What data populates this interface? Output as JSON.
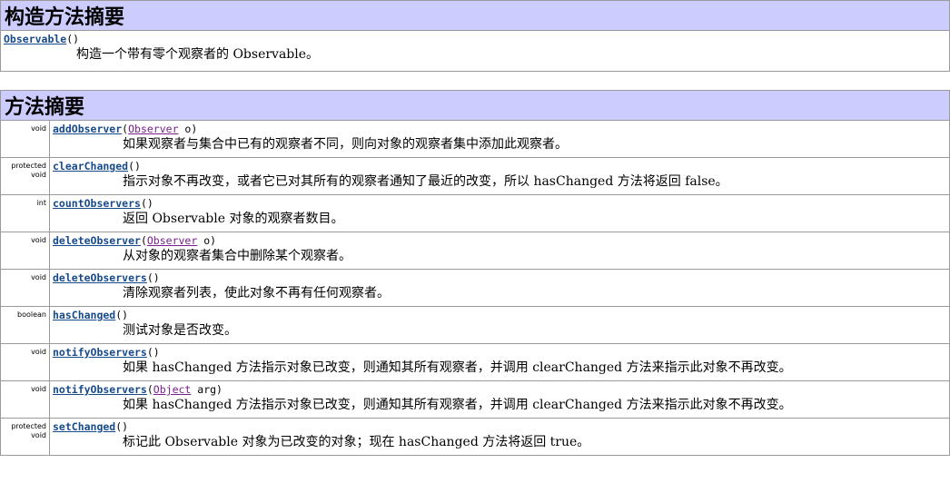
{
  "constructor_summary": {
    "title": "构造方法摘要",
    "items": [
      {
        "name": "Observable",
        "params": "()",
        "description": "构造一个带有零个观察者的 Observable。"
      }
    ]
  },
  "method_summary": {
    "title": "方法摘要",
    "rows": [
      {
        "modifier": [
          "void"
        ],
        "name": "addObserver",
        "sig_open": "(",
        "param_type": "Observer",
        "param_rest": " o)",
        "description": "如果观察者与集合中已有的观察者不同，则向对象的观察者集中添加此观察者。"
      },
      {
        "modifier": [
          "protected",
          "void"
        ],
        "name": "clearChanged",
        "sig_open": "()",
        "param_type": "",
        "param_rest": "",
        "description": "指示对象不再改变，或者它已对其所有的观察者通知了最近的改变，所以 hasChanged 方法将返回 false。"
      },
      {
        "modifier": [
          "int"
        ],
        "name": "countObservers",
        "sig_open": "()",
        "param_type": "",
        "param_rest": "",
        "description": "返回 Observable 对象的观察者数目。"
      },
      {
        "modifier": [
          "void"
        ],
        "name": "deleteObserver",
        "sig_open": "(",
        "param_type": "Observer",
        "param_rest": " o)",
        "description": "从对象的观察者集合中删除某个观察者。"
      },
      {
        "modifier": [
          "void"
        ],
        "name": "deleteObservers",
        "sig_open": "()",
        "param_type": "",
        "param_rest": "",
        "description": "清除观察者列表，使此对象不再有任何观察者。"
      },
      {
        "modifier": [
          "boolean"
        ],
        "name": "hasChanged",
        "sig_open": "()",
        "param_type": "",
        "param_rest": "",
        "description": "测试对象是否改变。"
      },
      {
        "modifier": [
          "void"
        ],
        "name": "notifyObservers",
        "sig_open": "()",
        "param_type": "",
        "param_rest": "",
        "description": "如果 hasChanged 方法指示对象已改变，则通知其所有观察者，并调用 clearChanged 方法来指示此对象不再改变。"
      },
      {
        "modifier": [
          "void"
        ],
        "name": "notifyObservers",
        "sig_open": "(",
        "param_type": "Object",
        "param_rest": " arg)",
        "description": "如果 hasChanged 方法指示对象已改变，则通知其所有观察者，并调用 clearChanged 方法来指示此对象不再改变。"
      },
      {
        "modifier": [
          "protected",
          "void"
        ],
        "name": "setChanged",
        "sig_open": "()",
        "param_type": "",
        "param_rest": "",
        "description": "标记此 Observable 对象为已改变的对象；现在 hasChanged 方法将返回 true。"
      }
    ]
  }
}
